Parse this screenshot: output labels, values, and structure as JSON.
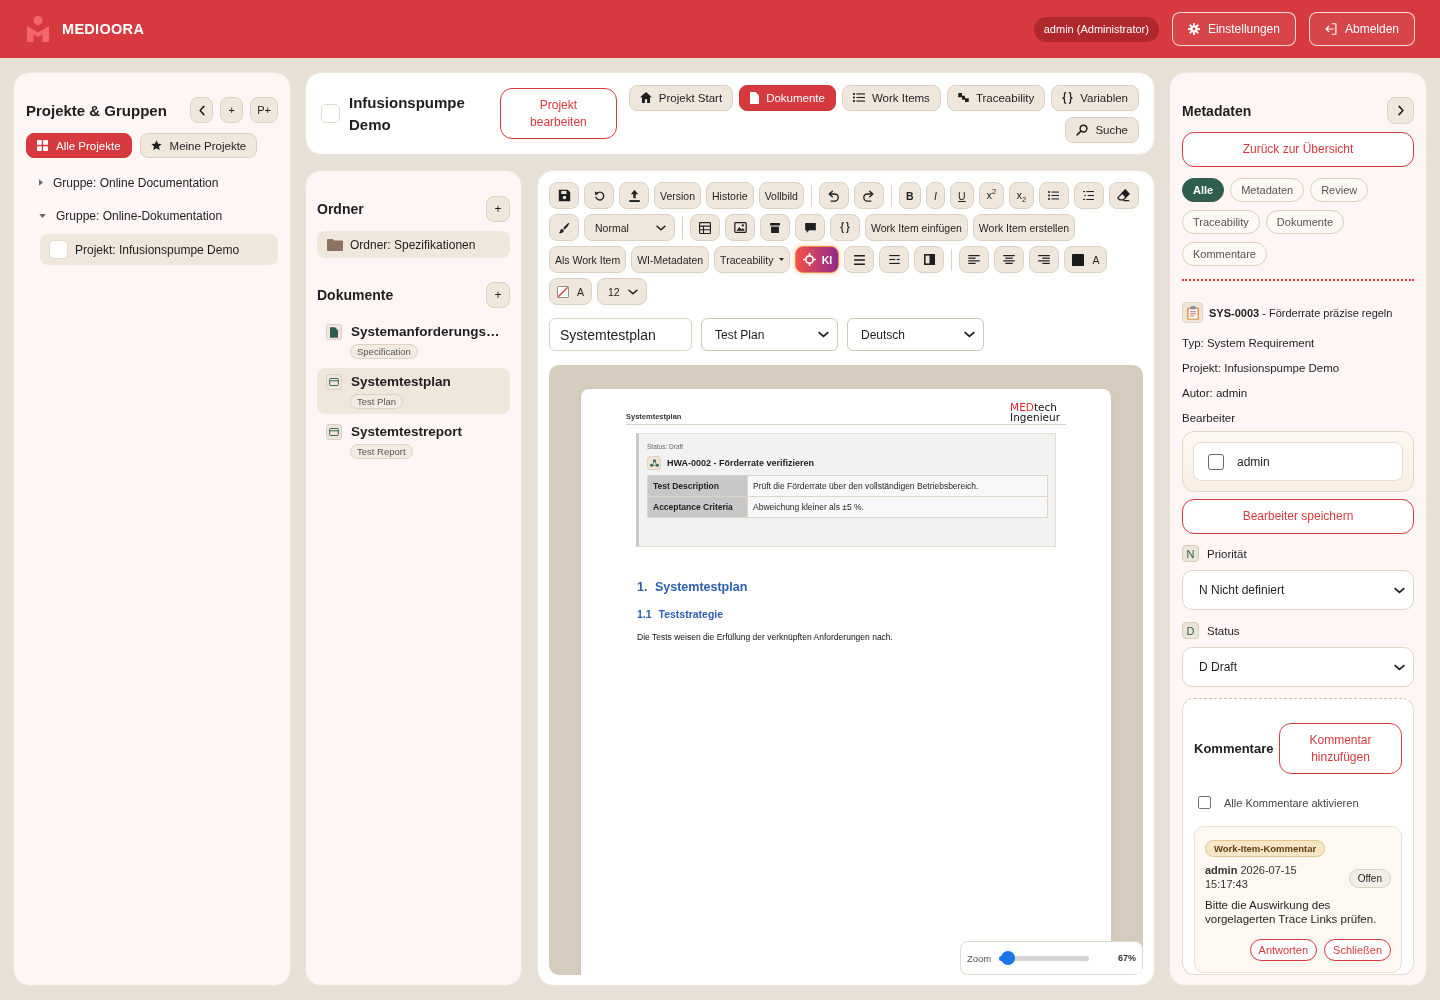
{
  "header": {
    "brand": "MEDIOORA",
    "user": "admin (Administrator)",
    "actions": [
      {
        "kind": "settings",
        "label": "Einstellungen"
      },
      {
        "kind": "logout",
        "label": "Abmelden"
      }
    ]
  },
  "projects_panel": {
    "title": "Projekte & Gruppen",
    "tools": [
      {
        "kind": "collapse"
      },
      {
        "kind": "text",
        "label": "+"
      },
      {
        "kind": "text",
        "label": "P+"
      }
    ],
    "filters": [
      {
        "kind": "all",
        "label": "Alle Projekte",
        "selected": true
      },
      {
        "kind": "mine",
        "label": "Meine Projekte",
        "selected": false
      }
    ],
    "tree": [
      {
        "label": "Gruppe: Online Documentation",
        "expanded": false
      },
      {
        "label": "Gruppe: Online-Dokumentation",
        "expanded": true,
        "children": [
          {
            "label": "Projekt: Infusionspumpe Demo",
            "selected": true
          }
        ]
      }
    ]
  },
  "project_bar": {
    "title": "Infusionspumpe Demo",
    "edit_button": "Projekt bearbeiten",
    "nav": [
      {
        "kind": "start",
        "label": "Projekt Start",
        "selected": false
      },
      {
        "kind": "documents",
        "label": "Dokumente",
        "selected": true
      },
      {
        "kind": "work_items",
        "label": "Work Items",
        "selected": false
      },
      {
        "kind": "traceability",
        "label": "Traceability",
        "selected": false
      },
      {
        "kind": "variables",
        "label": "Variablen",
        "selected": false
      },
      {
        "kind": "search",
        "label": "Suche",
        "selected": false
      }
    ]
  },
  "folders_panel": {
    "folders_title": "Ordner",
    "folders_add": "+",
    "folders": [
      {
        "label": "Ordner: Spezifikationen"
      }
    ],
    "documents_title": "Dokumente",
    "documents_add": "+",
    "documents": [
      {
        "kind": "specification",
        "title": "Systemanforderungs…",
        "type": "Specification",
        "selected": false
      },
      {
        "kind": "test_plan",
        "title": "Systemtestplan",
        "type": "Test Plan",
        "selected": true
      },
      {
        "kind": "test_report",
        "title": "Systemtestreport",
        "type": "Test Report",
        "selected": false
      }
    ]
  },
  "editor": {
    "toolbar": [
      [
        [
          {
            "kind": "save"
          },
          {
            "kind": "revert"
          },
          {
            "kind": "upload"
          },
          {
            "kind": "text",
            "label": "Version"
          },
          {
            "kind": "text",
            "label": "Historie"
          },
          {
            "kind": "text",
            "label": "Vollbild"
          }
        ],
        [
          {
            "kind": "undo"
          },
          {
            "kind": "redo"
          }
        ],
        [
          {
            "kind": "bold",
            "label": "B"
          },
          {
            "kind": "italic",
            "label": "I"
          },
          {
            "kind": "underline",
            "label": "U"
          },
          {
            "kind": "superscript",
            "label": "x$^{2}$"
          },
          {
            "kind": "subscript",
            "label": "x$_{2}$"
          },
          {
            "kind": "bullets"
          },
          {
            "kind": "numbering"
          },
          {
            "kind": "eraser"
          }
        ]
      ],
      [
        [
          {
            "kind": "brush"
          },
          {
            "kind": "select",
            "value": "Normal"
          }
        ],
        [
          {
            "kind": "table"
          },
          {
            "kind": "image"
          },
          {
            "kind": "block"
          },
          {
            "kind": "comment"
          },
          {
            "kind": "variable"
          },
          {
            "kind": "text",
            "label": "Work Item einfügen"
          },
          {
            "kind": "text",
            "label": "Work Item erstellen"
          }
        ]
      ],
      [
        [
          {
            "kind": "text",
            "label": "Als Work Item"
          },
          {
            "kind": "text",
            "label": "WI-Metadaten"
          },
          {
            "kind": "menu",
            "label": "Traceability"
          },
          {
            "kind": "ai",
            "label": "KI"
          },
          {
            "kind": "justify"
          },
          {
            "kind": "lines"
          },
          {
            "kind": "contrast"
          }
        ],
        [
          {
            "kind": "left"
          },
          {
            "kind": "center"
          },
          {
            "kind": "right"
          },
          {
            "kind": "text_color",
            "label": "A",
            "color": "#1a1a1a"
          }
        ]
      ],
      [
        [
          {
            "kind": "highlight",
            "label": "A"
          },
          {
            "kind": "select",
            "value": "12"
          }
        ]
      ]
    ],
    "document_fields": {
      "title": "Systemtestplan",
      "template": "Test Plan",
      "language": "Deutsch"
    },
    "page": {
      "running_header": "Systemtestplan",
      "logo": {
        "accent": "MED",
        "rest": "tech",
        "second_line": "Ingenieur"
      },
      "work_item": {
        "status": "Status: Draft",
        "title": "HWA-0002 - Förderrate verifizieren",
        "fields": [
          {
            "label": "Test Description",
            "value": "Prüft die Förderrate über den vollständigen Betriebsbereich."
          },
          {
            "label": "Acceptance Criteria",
            "value": "Abweichung kleiner als ±5 %."
          }
        ]
      },
      "content": [
        {
          "kind": "heading1",
          "number": "1.",
          "title": "Systemtestplan"
        },
        {
          "kind": "heading2",
          "number": "1.1",
          "title": "Teststrategie"
        },
        {
          "kind": "paragraph",
          "text": "Die Tests weisen die Erfüllung der verknüpften Anforderungen nach."
        }
      ]
    },
    "zoom": {
      "label": "Zoom",
      "level": 0.02,
      "reading": "67%"
    }
  },
  "metadata_panel": {
    "title": "Metadaten",
    "back_button": "Zurück zur Übersicht",
    "filters": [
      {
        "label": "Alle",
        "selected": true
      },
      {
        "label": "Metadaten",
        "selected": false
      },
      {
        "label": "Review",
        "selected": false
      },
      {
        "label": "Traceability",
        "selected": false
      },
      {
        "label": "Dokumente",
        "selected": false
      },
      {
        "label": "Kommentare",
        "selected": false
      }
    ],
    "item": {
      "title": "**SYS-0003** - Förderrate präzise regeln",
      "properties": [
        "Typ: System Requirement",
        "Projekt: Infusionspumpe Demo",
        "Autor: admin"
      ]
    },
    "assignees_label": "Bearbeiter",
    "assignees": [
      {
        "name": "admin",
        "checked": false
      }
    ],
    "save_button": "Bearbeiter speichern",
    "fields": [
      {
        "badge": "N",
        "label": "Priorität",
        "value": "N Nicht definiert"
      },
      {
        "badge": "D",
        "label": "Status",
        "value": "D Draft"
      }
    ],
    "comments": {
      "title": "Kommentare",
      "add_button": "Kommentar hinzufügen",
      "activate_all": {
        "label": "Alle Kommentare aktivieren",
        "checked": false
      },
      "items": [
        {
          "tag": "Work-Item-Kommentar",
          "author": "admin",
          "time": "2026-07-15 15:17:43",
          "state": "Offen",
          "text": "Bitte die Auswirkung des vorgelagerten Trace Links prüfen.",
          "actions": [
            "Antworten",
            "Schließen"
          ]
        }
      ]
    }
  }
}
